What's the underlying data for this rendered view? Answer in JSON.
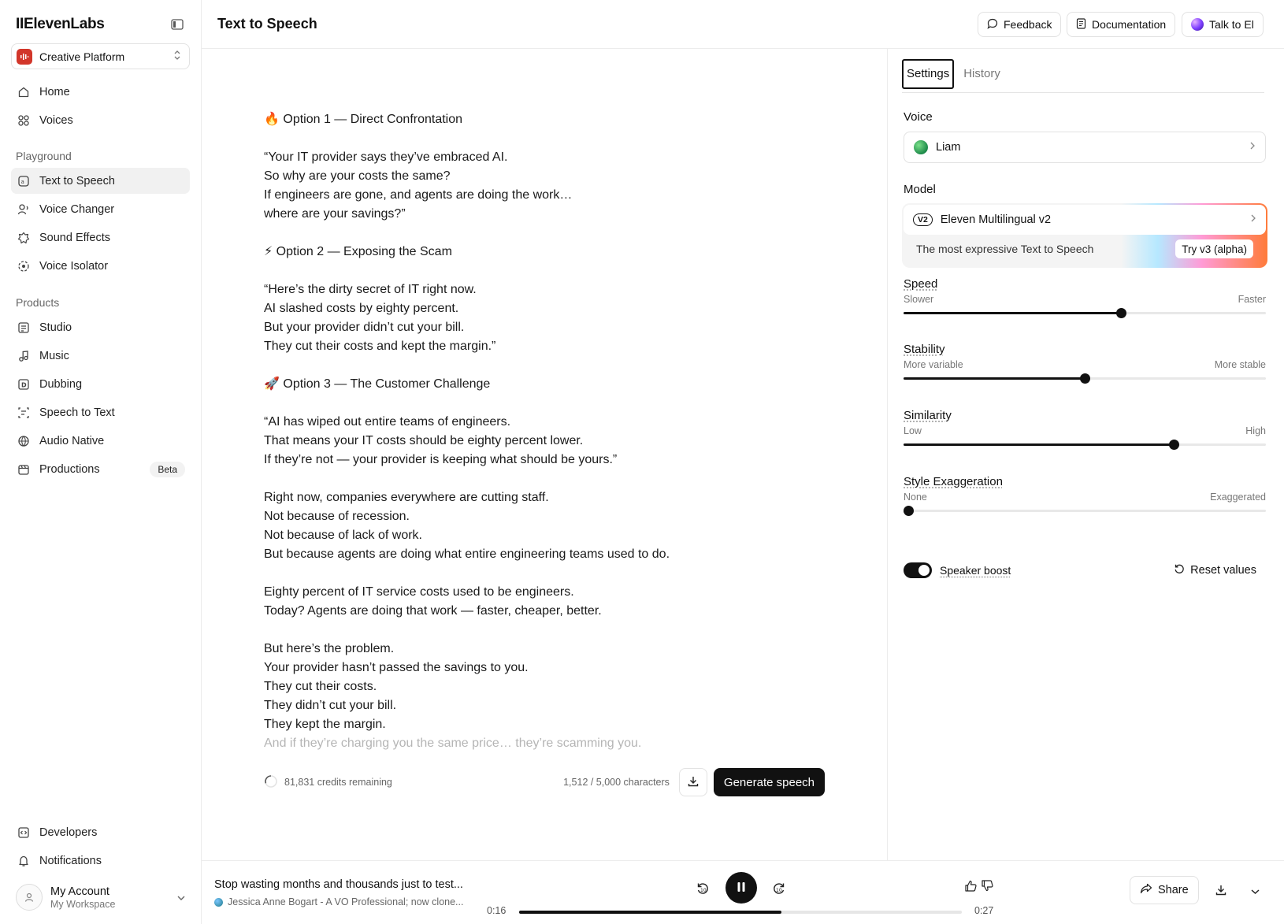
{
  "sidebar": {
    "logo": "IIElevenLabs",
    "platform": "Creative Platform",
    "top_items": [
      {
        "label": "Home",
        "icon": "home-icon"
      },
      {
        "label": "Voices",
        "icon": "voices-icon"
      }
    ],
    "playground_label": "Playground",
    "playground_items": [
      {
        "label": "Text to Speech",
        "icon": "text-to-speech-icon",
        "active": true
      },
      {
        "label": "Voice Changer",
        "icon": "voice-changer-icon"
      },
      {
        "label": "Sound Effects",
        "icon": "sound-effects-icon"
      },
      {
        "label": "Voice Isolator",
        "icon": "voice-isolator-icon"
      }
    ],
    "products_label": "Products",
    "products_items": [
      {
        "label": "Studio",
        "icon": "studio-icon"
      },
      {
        "label": "Music",
        "icon": "music-icon"
      },
      {
        "label": "Dubbing",
        "icon": "dubbing-icon"
      },
      {
        "label": "Speech to Text",
        "icon": "speech-to-text-icon"
      },
      {
        "label": "Audio Native",
        "icon": "globe-icon"
      },
      {
        "label": "Productions",
        "icon": "productions-icon",
        "badge": "Beta"
      }
    ],
    "bottom_items": [
      {
        "label": "Developers",
        "icon": "code-icon"
      },
      {
        "label": "Notifications",
        "icon": "bell-icon"
      }
    ],
    "account": {
      "name": "My Account",
      "workspace": "My Workspace"
    }
  },
  "header": {
    "title": "Text to Speech",
    "feedback": "Feedback",
    "documentation": "Documentation",
    "talk": "Talk to El"
  },
  "editor": {
    "paragraphs": [
      "🔥 Option 1 — Direct Confrontation",
      "“Your IT provider says they’ve embraced AI.\nSo why are your costs the same?\nIf engineers are gone, and agents are doing the work…\nwhere are your savings?”",
      "⚡ Option 2 — Exposing the Scam",
      "“Here’s the dirty secret of IT right now.\nAI slashed costs by eighty percent.\nBut your provider didn’t cut your bill.\nThey cut their costs and kept the margin.”",
      "🚀 Option 3 — The Customer Challenge",
      "“AI has wiped out entire teams of engineers.\nThat means your IT costs should be eighty percent lower.\nIf they’re not — your provider is keeping what should be yours.”",
      "Right now, companies everywhere are cutting staff.\nNot because of recession.\nNot because of lack of work.\nBut because agents are doing what entire engineering teams used to do.",
      "Eighty percent of IT service costs used to be engineers.\nToday? Agents are doing that work — faster, cheaper, better.",
      "But here’s the problem.\nYour provider hasn’t passed the savings to you.\nThey cut their costs.\nThey didn’t cut your bill.\nThey kept the margin."
    ],
    "faded_line": "And if they’re charging you the same price… they’re scamming you.",
    "credits": "81,831 credits remaining",
    "characters": "1,512 / 5,000 characters",
    "generate": "Generate speech"
  },
  "settings": {
    "tabs": [
      "Settings",
      "History"
    ],
    "voice_label": "Voice",
    "voice": "Liam",
    "model_label": "Model",
    "model_badge": "V2",
    "model": "Eleven Multilingual v2",
    "promo": "The most expressive Text to Speech",
    "try_button": "Try v3 (alpha)",
    "sliders": [
      {
        "title": "Speed",
        "low": "Slower",
        "high": "Faster",
        "value": 0.6
      },
      {
        "title": "Stability",
        "low": "More variable",
        "high": "More stable",
        "value": 0.5
      },
      {
        "title": "Similarity",
        "low": "Low",
        "high": "High",
        "value": 0.745
      },
      {
        "title": "Style Exaggeration",
        "low": "None",
        "high": "Exaggerated",
        "value": 0.0
      }
    ],
    "speaker_boost": "Speaker boost",
    "speaker_boost_on": true,
    "reset": "Reset values"
  },
  "player": {
    "title": "Stop wasting months and thousands just to test...",
    "subtitle": "Jessica Anne Bogart - A VO Professional; now clone...",
    "current": "0:16",
    "total": "0:27",
    "progress": 0.5926,
    "share": "Share"
  }
}
